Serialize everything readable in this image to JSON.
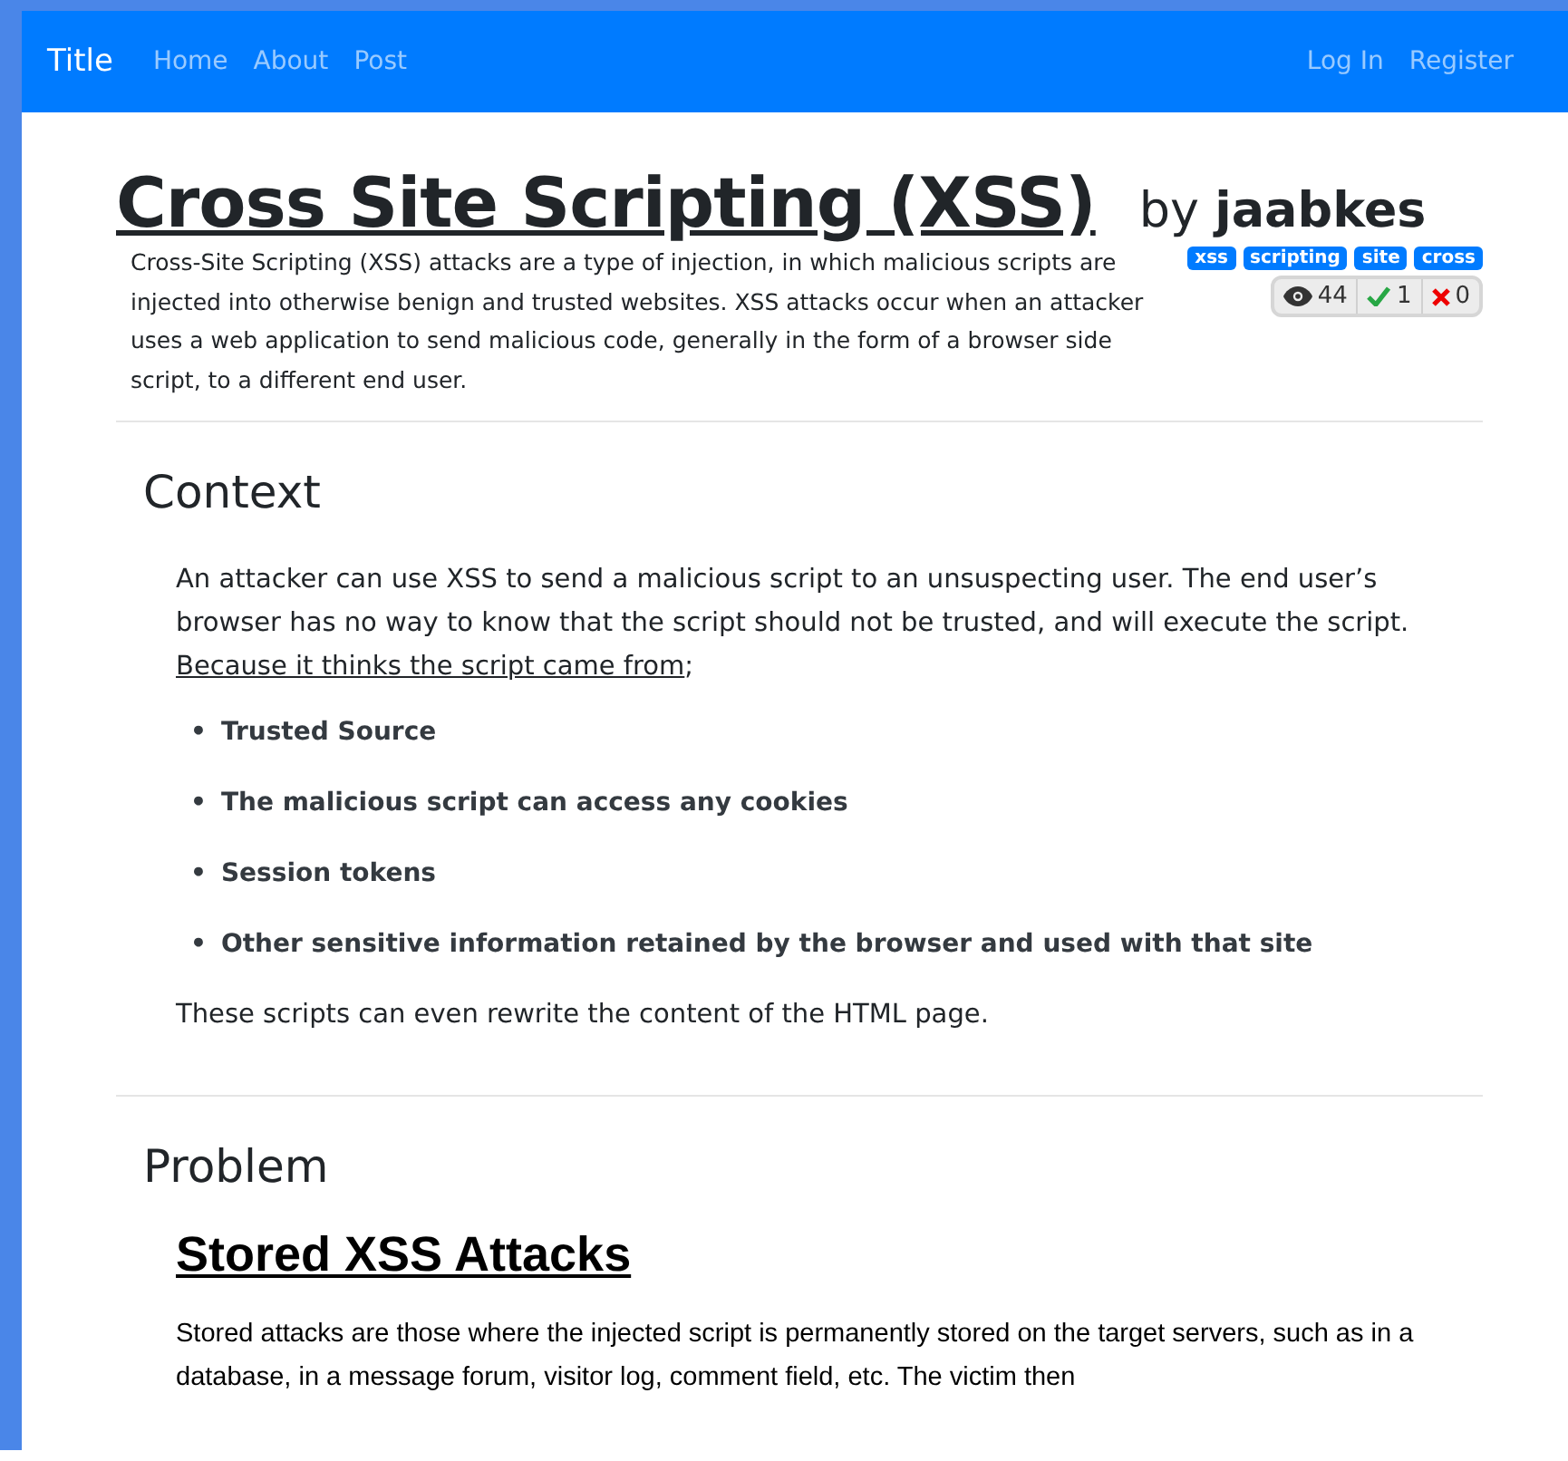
{
  "navbar": {
    "brand": "Title",
    "links": [
      {
        "label": "Home"
      },
      {
        "label": "About"
      },
      {
        "label": "Post"
      }
    ],
    "right_links": [
      {
        "label": "Log In"
      },
      {
        "label": "Register"
      }
    ]
  },
  "post": {
    "title": "Cross Site Scripting (XSS)",
    "by": "by",
    "author": "jaabkes",
    "summary": "Cross-Site Scripting (XSS) attacks are a type of injection, in which malicious scripts are injected into otherwise benign and trusted websites. XSS attacks occur when an attacker uses a web application to send malicious code, generally in the form of a browser side script, to a different end user.",
    "tags": [
      "xss",
      "scripting",
      "site",
      "cross"
    ],
    "stats": [
      {
        "kind": "views",
        "value": "44"
      },
      {
        "kind": "likes",
        "value": "1"
      },
      {
        "kind": "dislikes",
        "value": "0"
      }
    ]
  },
  "sections": [
    {
      "heading": "Context",
      "paragraph": "An attacker can use XSS to send a malicious script to an unsuspecting user. The end user’s browser has no way to know that the script should not be trusted, and will execute the script.",
      "link": "Because it thinks the script came from",
      "link_suffix": ";",
      "bullets": [
        {
          "marker": "•",
          "text": "Trusted Source"
        },
        {
          "marker": "•",
          "text": "The malicious script can access any cookies"
        },
        {
          "marker": "•",
          "text": "Session tokens"
        },
        {
          "marker": "•",
          "text": "Other sensitive information retained by the browser and used with that site"
        }
      ],
      "closing": "These scripts can even rewrite the content of the HTML page."
    },
    {
      "heading": "Problem",
      "subheading": "Stored XSS Attacks",
      "paragraph": "Stored attacks are those where the injected script is permanently stored on the target servers, such as in a database, in a message forum, visitor log, comment field, etc. The victim then"
    }
  ]
}
